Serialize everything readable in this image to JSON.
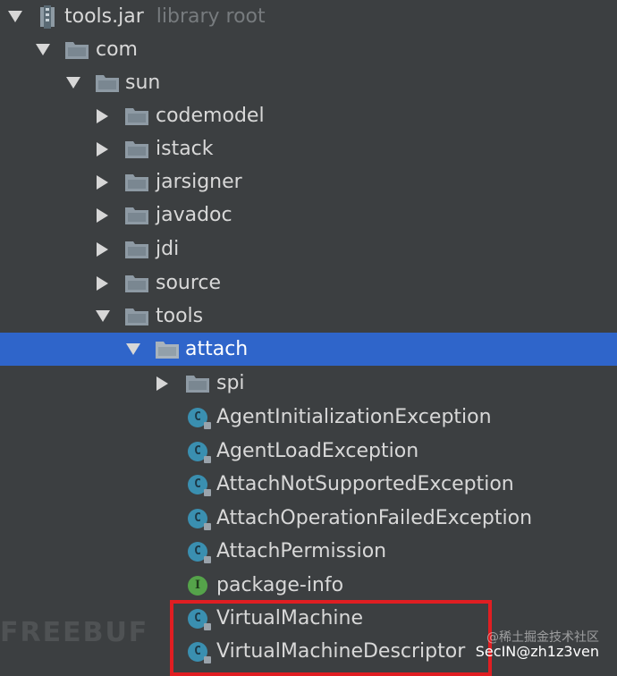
{
  "tree": {
    "root": {
      "label": "tools.jar",
      "hint": "library root"
    },
    "nodes": [
      {
        "label": "com"
      },
      {
        "label": "sun"
      },
      {
        "label": "codemodel"
      },
      {
        "label": "istack"
      },
      {
        "label": "jarsigner"
      },
      {
        "label": "javadoc"
      },
      {
        "label": "jdi"
      },
      {
        "label": "source"
      },
      {
        "label": "tools"
      },
      {
        "label": "attach"
      },
      {
        "label": "spi"
      },
      {
        "label": "AgentInitializationException"
      },
      {
        "label": "AgentLoadException"
      },
      {
        "label": "AttachNotSupportedException"
      },
      {
        "label": "AttachOperationFailedException"
      },
      {
        "label": "AttachPermission"
      },
      {
        "label": "package-info"
      },
      {
        "label": "VirtualMachine"
      },
      {
        "label": "VirtualMachineDescriptor"
      }
    ]
  },
  "icons": {
    "class_letter": "C",
    "interface_letter": "I"
  },
  "watermarks": {
    "left": "FREEBUF",
    "cn": "@稀土掘金技术社区",
    "secin": "SecIN@zh1z3ven"
  },
  "colors": {
    "background": "#3c3f41",
    "selection": "#2f65ca",
    "highlight_box": "#e01e22"
  }
}
